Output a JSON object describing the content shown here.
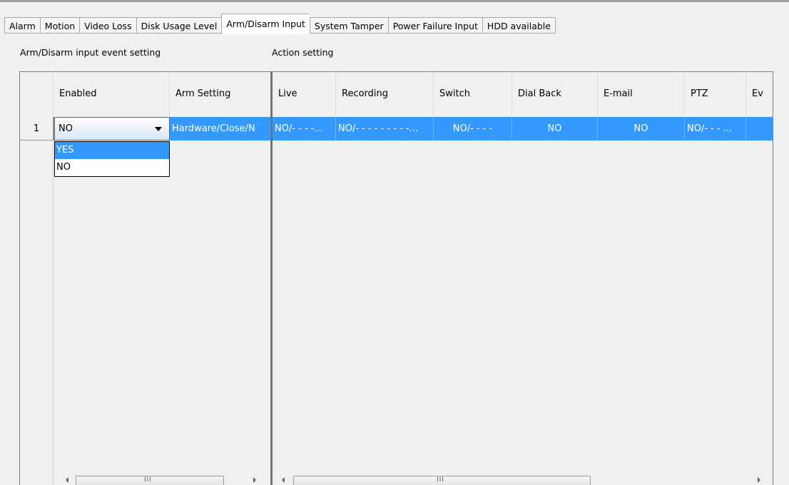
{
  "tabs": [
    {
      "label": "Alarm"
    },
    {
      "label": "Motion"
    },
    {
      "label": "Video Loss"
    },
    {
      "label": "Disk Usage Level"
    },
    {
      "label": "Arm/Disarm Input",
      "active": true
    },
    {
      "label": "System Tamper"
    },
    {
      "label": "Power Failure Input"
    },
    {
      "label": "HDD available"
    }
  ],
  "left_section": {
    "label": "Arm/Disarm input event setting",
    "columns": [
      "Enabled",
      "Arm Setting"
    ]
  },
  "right_section": {
    "label": "Action setting",
    "columns": [
      "Live",
      "Recording",
      "Switch",
      "Dial Back",
      "E-mail",
      "PTZ",
      "Ev"
    ]
  },
  "rows": [
    {
      "number": "1",
      "enabled": "NO",
      "arm_setting": "Hardware/Close/N",
      "live": "NO/- - - -...",
      "recording": "NO/- - - - - - - - -...",
      "switch": "NO/- - - -",
      "dial_back": "NO",
      "email": "NO",
      "ptz": "NO/- - - ...",
      "ev": ""
    }
  ],
  "dropdown": {
    "options": [
      "YES",
      "NO"
    ],
    "highlighted": "YES"
  },
  "scrollbar": {
    "grip": "III"
  },
  "colors": {
    "selection": "#3399ff",
    "background": "#f0f0f0"
  }
}
